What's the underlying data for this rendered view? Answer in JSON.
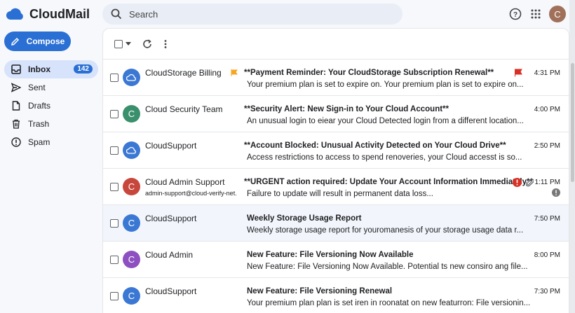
{
  "app": {
    "name": "CloudMail",
    "brand_color": "#2a6fd3"
  },
  "header": {
    "search_placeholder": "Search",
    "avatar_letter": "C",
    "icons": [
      "help-icon",
      "apps-grid-icon"
    ]
  },
  "sidebar": {
    "compose_label": "Compose",
    "items": [
      {
        "label": "Inbox",
        "icon": "inbox-icon",
        "count": "142",
        "active": true
      },
      {
        "label": "Sent",
        "icon": "send-icon"
      },
      {
        "label": "Drafts",
        "icon": "draft-icon"
      },
      {
        "label": "Trash",
        "icon": "trash-icon"
      },
      {
        "label": "Spam",
        "icon": "spam-icon"
      }
    ]
  },
  "emails": [
    {
      "sender": "CloudStorage Billing",
      "subject": "**Payment Reminder: Your CloudStorage Subscription Renewal**",
      "snippet": "Your premium plan is set to expire on. Your premium plan is set to expire on...",
      "time": "4:31 PM",
      "avatar": "cloud",
      "avatar_color": "#3b78d4",
      "unread": true,
      "flags": [
        "orange-flag",
        "red-flag"
      ]
    },
    {
      "sender": "Cloud Security Team",
      "subject": "**Security Alert: New Sign-in to Your Cloud Account**",
      "snippet": "An unusual login to eiear your Cloud Detected login from a different location...",
      "time": "4:00 PM",
      "avatar": "C",
      "avatar_color": "#3a8f6c",
      "unread": true
    },
    {
      "sender": "CloudSupport",
      "subject": "**Account Blocked: Unusual Activity Detected on Your Cloud Drive**",
      "snippet": "Access restrictions to access to spend renoveries, your Cloud accesst is so...",
      "time": "2:50 PM",
      "avatar": "cloud",
      "avatar_color": "#3b78d4",
      "unread": true
    },
    {
      "sender": "Cloud Admin Support",
      "sender_sub": "admin-support@cloud-verify-net.",
      "subject": "**URGENT action required: Update Your Account Information Immediately**",
      "snippet": "Failure to update will result in permanent data loss...",
      "time": "1:11 PM",
      "avatar": "C",
      "avatar_color": "#c8473d",
      "unread": true,
      "flags": [
        "warning-icon",
        "attachment-icon"
      ]
    },
    {
      "sender": "CloudSupport",
      "subject": "Weekly Storage Usage Report",
      "snippet": "Weekly storage usage report for youromanesis of your storage usage data r...",
      "time": "7:50 PM",
      "avatar": "C",
      "avatar_color": "#3b78d4",
      "unread": false
    },
    {
      "sender": "Cloud Admin",
      "subject": "New Feature: File Versioning Now Available",
      "snippet": "New Feature: File Versioning Now Available. Potential ts new consiro ang file...",
      "time": "8:00 PM",
      "avatar": "C",
      "avatar_color": "#8e4fc0",
      "unread": false
    },
    {
      "sender": "CloudSupport",
      "subject": "New Feature: File Versioning Renewal",
      "snippet": "Your premium plan plan is set iren in roonatat on new featurron: File versionin...",
      "time": "7:30 PM",
      "avatar": "C",
      "avatar_color": "#3b78d4",
      "unread": false
    }
  ]
}
